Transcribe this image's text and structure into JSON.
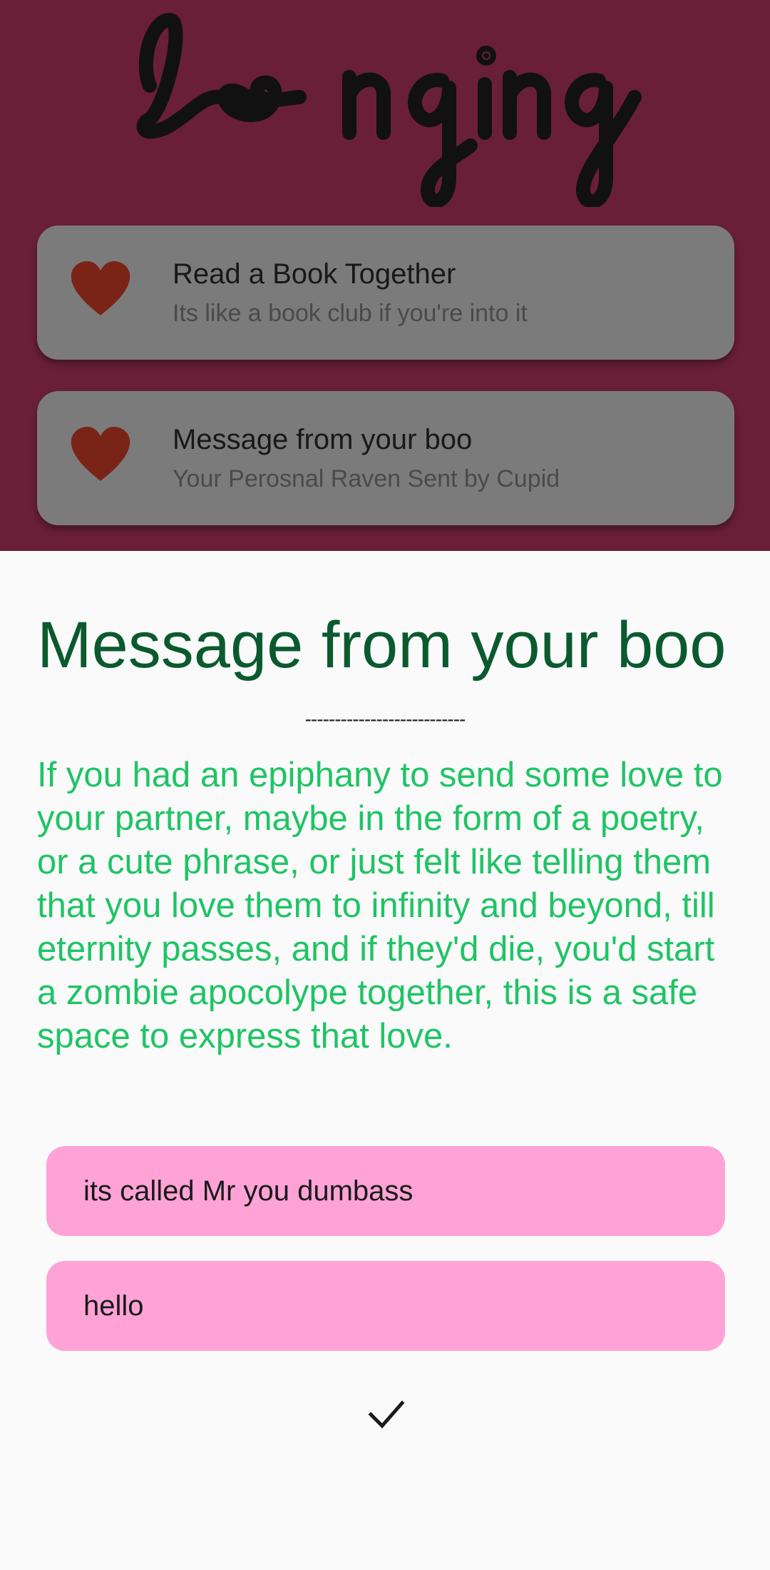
{
  "app": {
    "logo_text": "longing"
  },
  "cards": [
    {
      "title": "Read a Book Together",
      "subtitle": "Its like a book club if you're into it",
      "icon": "heart-icon"
    },
    {
      "title": "Message from your boo",
      "subtitle": "Your Perosnal Raven Sent by Cupid",
      "icon": "heart-icon"
    }
  ],
  "sheet": {
    "title": "Message from your boo",
    "divider": "---------------------------",
    "description": "If you had an epiphany to send some love to your partner, maybe in the form of a poetry, or a cute phrase, or just felt like telling them that you love them to infinity and beyond, till eternity passes, and if they'd die, you'd start a zombie apocolype together, this is a safe space to express that love.",
    "messages": [
      {
        "text": "its called Mr you dumbass"
      },
      {
        "text": "hello"
      }
    ],
    "confirm_icon": "checkmark-icon"
  },
  "colors": {
    "background_overlay": "#6a1f38",
    "card": "#7c7b7b",
    "heart": "#7a2418",
    "sheet_title": "#0b5a2f",
    "description": "#1fc465",
    "message_bubble": "#ffa3d6"
  }
}
